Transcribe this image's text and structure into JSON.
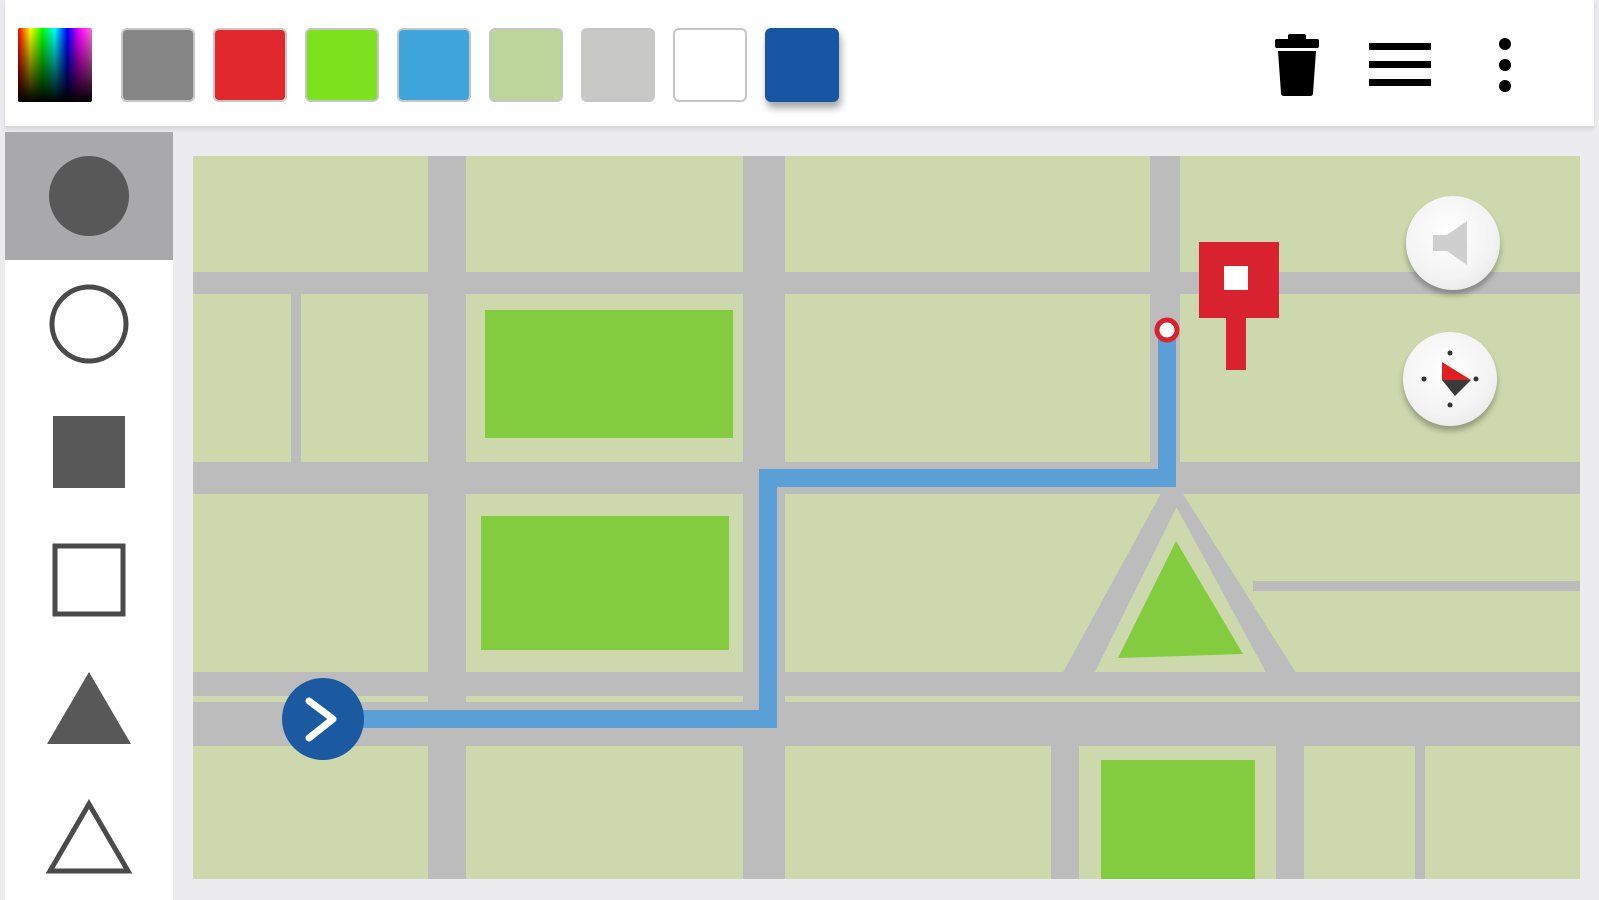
{
  "colors": {
    "accent_blue": "#1b5aa0",
    "route_blue": "#5a9fd6",
    "pin_red": "#d8222f",
    "park_green": "#84cc3f",
    "block_green": "#cdd8ad",
    "road_gray": "#bcbcbc",
    "icon_dark": "#585858"
  },
  "toolbar": {
    "swatches": [
      {
        "name": "spectrum",
        "color": "multicolor",
        "selected": false
      },
      {
        "name": "gray",
        "color": "#858585",
        "selected": false
      },
      {
        "name": "red",
        "color": "#e0282d",
        "selected": false
      },
      {
        "name": "lime",
        "color": "#7ce21e",
        "selected": false
      },
      {
        "name": "sky-blue",
        "color": "#3ea6dd",
        "selected": false
      },
      {
        "name": "sage",
        "color": "#bcd59b",
        "selected": false
      },
      {
        "name": "light-gray",
        "color": "#c8c8c6",
        "selected": false
      },
      {
        "name": "white",
        "color": "#ffffff",
        "selected": false
      },
      {
        "name": "navy",
        "color": "#1656a3",
        "selected": true
      }
    ],
    "icons": [
      "trash-icon",
      "menu-icon",
      "more-vert-icon"
    ]
  },
  "shapes": [
    {
      "name": "filled-circle",
      "selected": true
    },
    {
      "name": "outline-circle",
      "selected": false
    },
    {
      "name": "filled-square",
      "selected": false
    },
    {
      "name": "outline-square",
      "selected": false
    },
    {
      "name": "filled-triangle",
      "selected": false
    },
    {
      "name": "outline-triangle",
      "selected": false
    }
  ],
  "map": {
    "controls": [
      "volume-mute-icon",
      "compass-icon"
    ],
    "markers": [
      "start-arrow-icon",
      "destination-flag-icon"
    ]
  }
}
